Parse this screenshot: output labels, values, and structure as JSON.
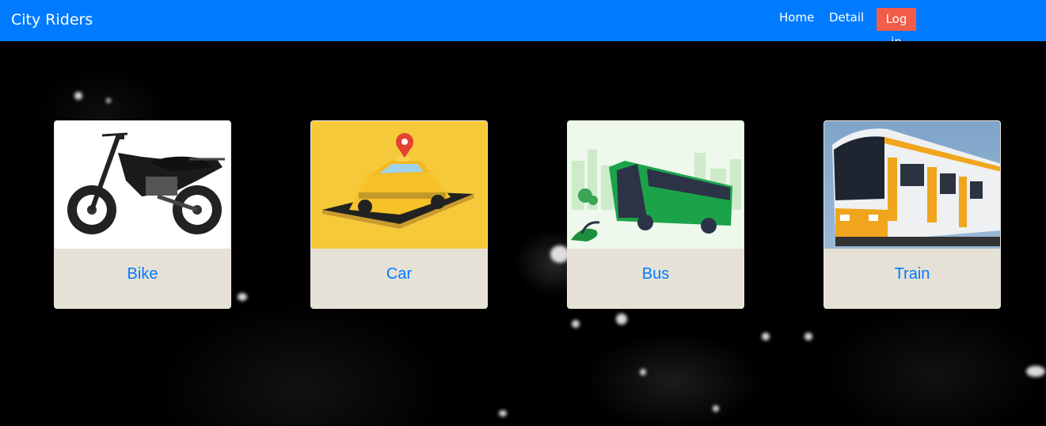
{
  "navbar": {
    "brand": "City Riders",
    "links": [
      {
        "label": "Home"
      },
      {
        "label": "Detail"
      }
    ],
    "login_label": "Log in",
    "colors": {
      "bar": "#007bff",
      "login": "#f25c4a"
    }
  },
  "cards": [
    {
      "title": "Bike",
      "image": "motorcycle-image"
    },
    {
      "title": "Car",
      "image": "taxi-car-image"
    },
    {
      "title": "Bus",
      "image": "green-bus-image"
    },
    {
      "title": "Train",
      "image": "train-image"
    }
  ],
  "colors": {
    "card_body": "#e6e1d6",
    "card_title": "#007bff",
    "background": "#000000"
  }
}
